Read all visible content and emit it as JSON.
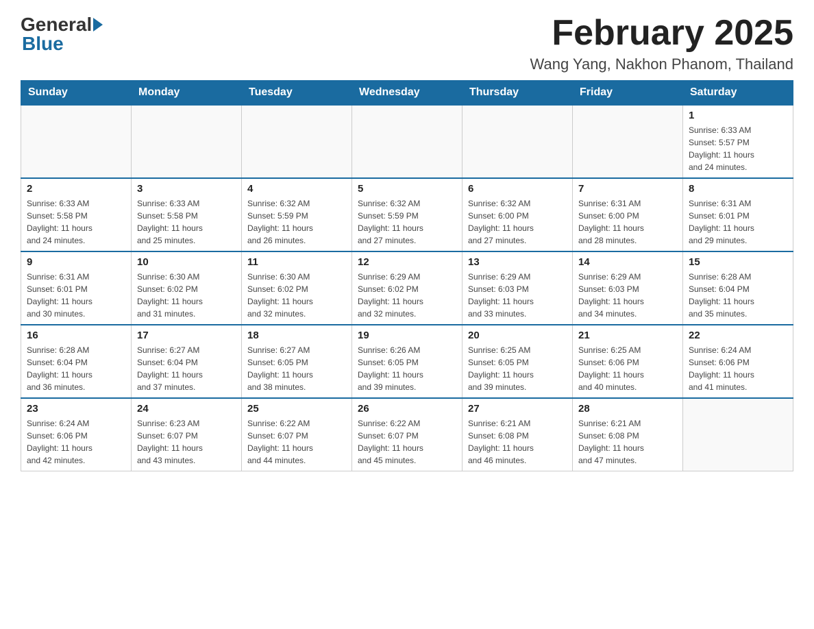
{
  "header": {
    "logo_general": "General",
    "logo_blue": "Blue",
    "title": "February 2025",
    "subtitle": "Wang Yang, Nakhon Phanom, Thailand"
  },
  "days_of_week": [
    "Sunday",
    "Monday",
    "Tuesday",
    "Wednesday",
    "Thursday",
    "Friday",
    "Saturday"
  ],
  "weeks": [
    [
      {
        "day": "",
        "info": ""
      },
      {
        "day": "",
        "info": ""
      },
      {
        "day": "",
        "info": ""
      },
      {
        "day": "",
        "info": ""
      },
      {
        "day": "",
        "info": ""
      },
      {
        "day": "",
        "info": ""
      },
      {
        "day": "1",
        "info": "Sunrise: 6:33 AM\nSunset: 5:57 PM\nDaylight: 11 hours\nand 24 minutes."
      }
    ],
    [
      {
        "day": "2",
        "info": "Sunrise: 6:33 AM\nSunset: 5:58 PM\nDaylight: 11 hours\nand 24 minutes."
      },
      {
        "day": "3",
        "info": "Sunrise: 6:33 AM\nSunset: 5:58 PM\nDaylight: 11 hours\nand 25 minutes."
      },
      {
        "day": "4",
        "info": "Sunrise: 6:32 AM\nSunset: 5:59 PM\nDaylight: 11 hours\nand 26 minutes."
      },
      {
        "day": "5",
        "info": "Sunrise: 6:32 AM\nSunset: 5:59 PM\nDaylight: 11 hours\nand 27 minutes."
      },
      {
        "day": "6",
        "info": "Sunrise: 6:32 AM\nSunset: 6:00 PM\nDaylight: 11 hours\nand 27 minutes."
      },
      {
        "day": "7",
        "info": "Sunrise: 6:31 AM\nSunset: 6:00 PM\nDaylight: 11 hours\nand 28 minutes."
      },
      {
        "day": "8",
        "info": "Sunrise: 6:31 AM\nSunset: 6:01 PM\nDaylight: 11 hours\nand 29 minutes."
      }
    ],
    [
      {
        "day": "9",
        "info": "Sunrise: 6:31 AM\nSunset: 6:01 PM\nDaylight: 11 hours\nand 30 minutes."
      },
      {
        "day": "10",
        "info": "Sunrise: 6:30 AM\nSunset: 6:02 PM\nDaylight: 11 hours\nand 31 minutes."
      },
      {
        "day": "11",
        "info": "Sunrise: 6:30 AM\nSunset: 6:02 PM\nDaylight: 11 hours\nand 32 minutes."
      },
      {
        "day": "12",
        "info": "Sunrise: 6:29 AM\nSunset: 6:02 PM\nDaylight: 11 hours\nand 32 minutes."
      },
      {
        "day": "13",
        "info": "Sunrise: 6:29 AM\nSunset: 6:03 PM\nDaylight: 11 hours\nand 33 minutes."
      },
      {
        "day": "14",
        "info": "Sunrise: 6:29 AM\nSunset: 6:03 PM\nDaylight: 11 hours\nand 34 minutes."
      },
      {
        "day": "15",
        "info": "Sunrise: 6:28 AM\nSunset: 6:04 PM\nDaylight: 11 hours\nand 35 minutes."
      }
    ],
    [
      {
        "day": "16",
        "info": "Sunrise: 6:28 AM\nSunset: 6:04 PM\nDaylight: 11 hours\nand 36 minutes."
      },
      {
        "day": "17",
        "info": "Sunrise: 6:27 AM\nSunset: 6:04 PM\nDaylight: 11 hours\nand 37 minutes."
      },
      {
        "day": "18",
        "info": "Sunrise: 6:27 AM\nSunset: 6:05 PM\nDaylight: 11 hours\nand 38 minutes."
      },
      {
        "day": "19",
        "info": "Sunrise: 6:26 AM\nSunset: 6:05 PM\nDaylight: 11 hours\nand 39 minutes."
      },
      {
        "day": "20",
        "info": "Sunrise: 6:25 AM\nSunset: 6:05 PM\nDaylight: 11 hours\nand 39 minutes."
      },
      {
        "day": "21",
        "info": "Sunrise: 6:25 AM\nSunset: 6:06 PM\nDaylight: 11 hours\nand 40 minutes."
      },
      {
        "day": "22",
        "info": "Sunrise: 6:24 AM\nSunset: 6:06 PM\nDaylight: 11 hours\nand 41 minutes."
      }
    ],
    [
      {
        "day": "23",
        "info": "Sunrise: 6:24 AM\nSunset: 6:06 PM\nDaylight: 11 hours\nand 42 minutes."
      },
      {
        "day": "24",
        "info": "Sunrise: 6:23 AM\nSunset: 6:07 PM\nDaylight: 11 hours\nand 43 minutes."
      },
      {
        "day": "25",
        "info": "Sunrise: 6:22 AM\nSunset: 6:07 PM\nDaylight: 11 hours\nand 44 minutes."
      },
      {
        "day": "26",
        "info": "Sunrise: 6:22 AM\nSunset: 6:07 PM\nDaylight: 11 hours\nand 45 minutes."
      },
      {
        "day": "27",
        "info": "Sunrise: 6:21 AM\nSunset: 6:08 PM\nDaylight: 11 hours\nand 46 minutes."
      },
      {
        "day": "28",
        "info": "Sunrise: 6:21 AM\nSunset: 6:08 PM\nDaylight: 11 hours\nand 47 minutes."
      },
      {
        "day": "",
        "info": ""
      }
    ]
  ]
}
